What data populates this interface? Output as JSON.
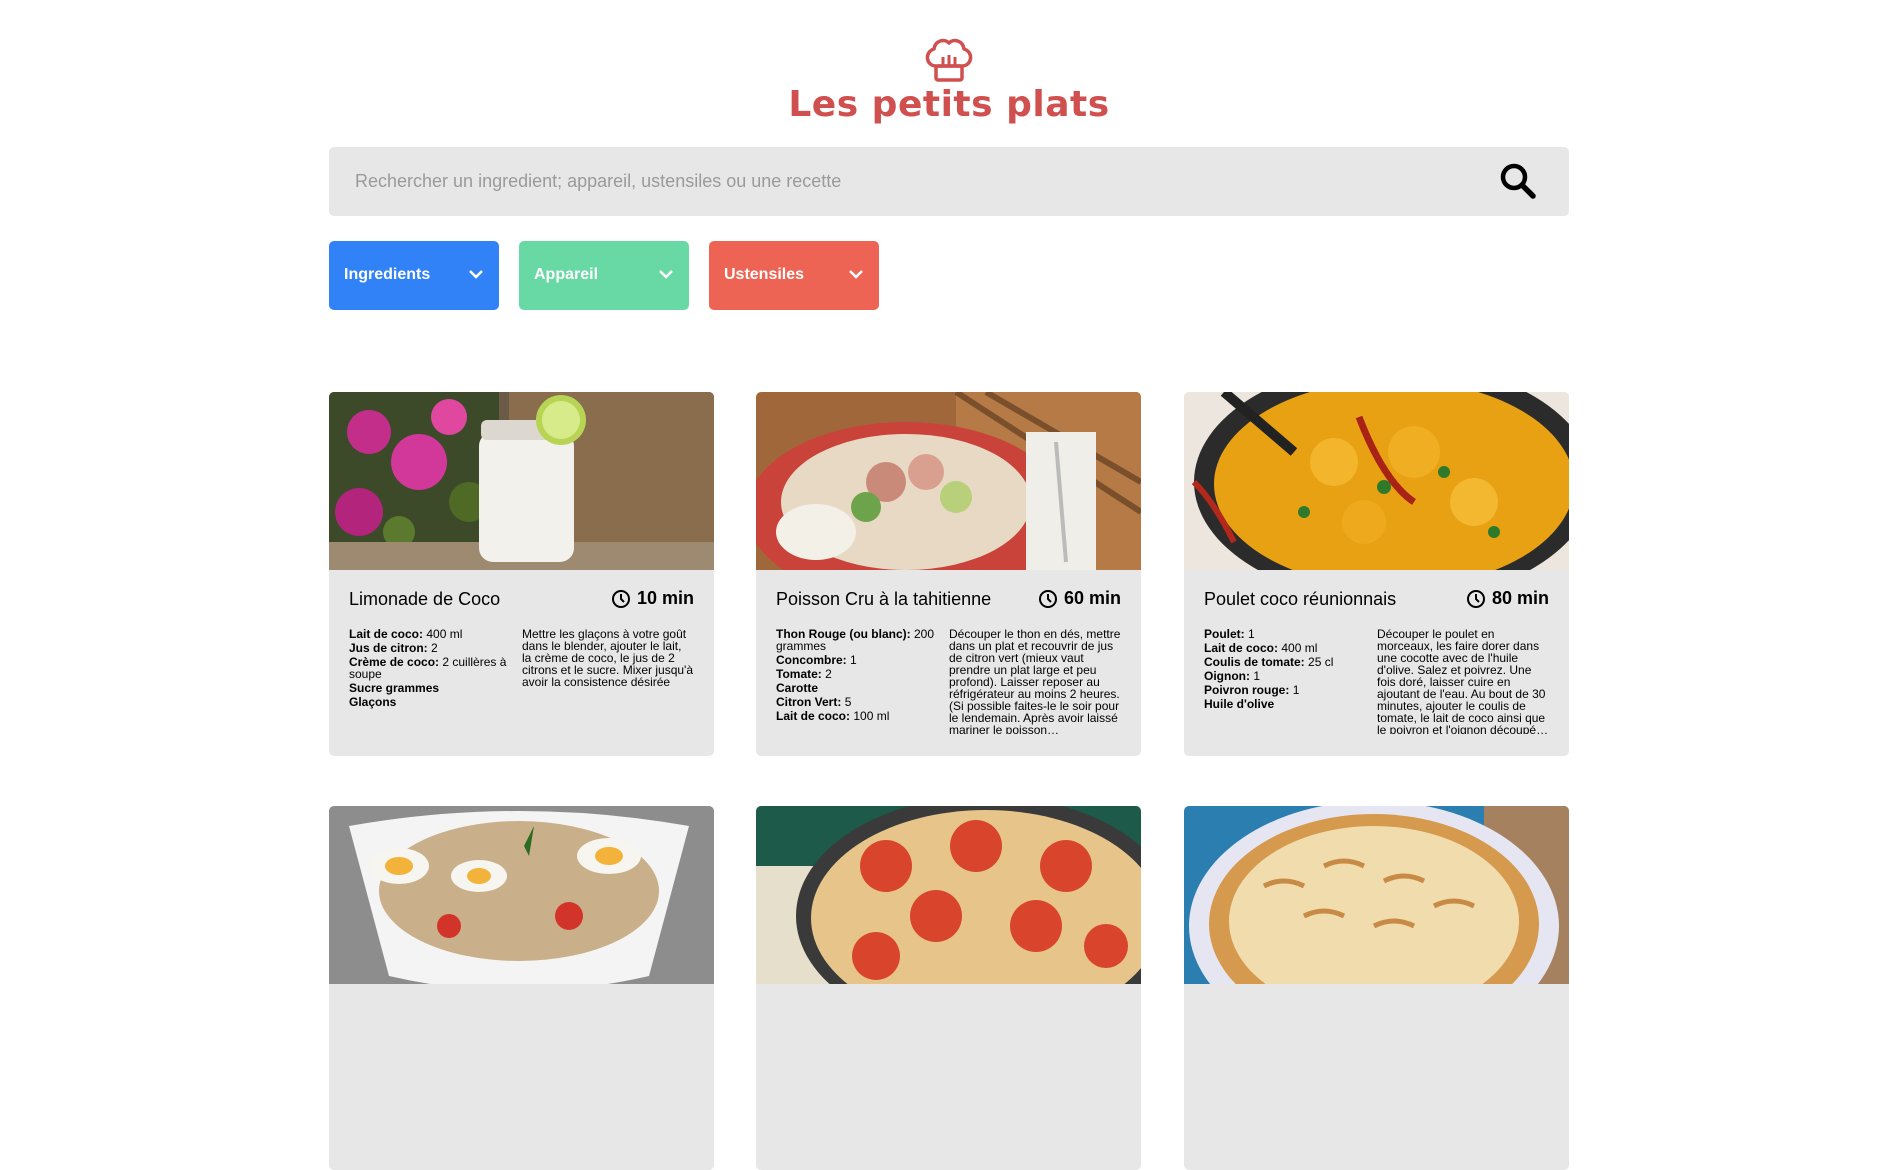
{
  "header": {
    "title": "Les petits plats",
    "logo_icon": "chef-hat-icon",
    "brand_color": "#D04F4F"
  },
  "search": {
    "placeholder": "Rechercher un ingredient; appareil, ustensiles ou une recette",
    "value": "",
    "icon": "search-icon"
  },
  "filters": [
    {
      "label": "Ingredients",
      "color": "#3282F7"
    },
    {
      "label": "Appareil",
      "color": "#68D9A4"
    },
    {
      "label": "Ustensiles",
      "color": "#ED6454"
    }
  ],
  "recipes": [
    {
      "name": "Limonade de Coco",
      "time": "10 min",
      "ingredients": [
        {
          "name": "Lait de coco:",
          "qty": "400 ml"
        },
        {
          "name": "Jus de citron:",
          "qty": "2"
        },
        {
          "name": "Crème de coco:",
          "qty": "2 cuillères à soupe"
        },
        {
          "name": "Sucre grammes",
          "qty": ""
        },
        {
          "name": "Glaçons",
          "qty": ""
        }
      ],
      "description": "Mettre les glaçons à votre goût dans le blender, ajouter le lait, la crème de coco, le jus de 2 citrons et le sucre. Mixer jusqu'à avoir la consistence désirée"
    },
    {
      "name": "Poisson Cru à la tahitienne",
      "time": "60 min",
      "ingredients": [
        {
          "name": "Thon Rouge (ou blanc):",
          "qty": "200 grammes"
        },
        {
          "name": "Concombre:",
          "qty": "1"
        },
        {
          "name": "Tomate:",
          "qty": "2"
        },
        {
          "name": "Carotte",
          "qty": ""
        },
        {
          "name": "Citron Vert:",
          "qty": "5"
        },
        {
          "name": "Lait de coco:",
          "qty": "100 ml"
        }
      ],
      "description": "Découper le thon en dés, mettre dans un plat et recouvrir de jus de citron vert (mieux vaut prendre un plat large et peu profond). Laisser reposer au réfrigérateur au moins 2 heures. (Si possible faites-le le soir pour le lendemain. Après avoir laissé mariner le poisson…"
    },
    {
      "name": "Poulet coco réunionnais",
      "time": "80 min",
      "ingredients": [
        {
          "name": "Poulet:",
          "qty": "1"
        },
        {
          "name": "Lait de coco:",
          "qty": "400 ml"
        },
        {
          "name": "Coulis de tomate:",
          "qty": "25 cl"
        },
        {
          "name": "Oignon:",
          "qty": "1"
        },
        {
          "name": "Poivron rouge:",
          "qty": "1"
        },
        {
          "name": "Huile d'olive",
          "qty": ""
        }
      ],
      "description": "Découper le poulet en morceaux, les faire dorer dans une cocotte avec de l'huile d'olive. Salez et poivrez. Une fois doré, laisser cuire en ajoutant de l'eau. Au bout de 30 minutes, ajouter le coulis de tomate, le lait de coco ainsi que le poivron et l'oignon découpé…"
    }
  ]
}
